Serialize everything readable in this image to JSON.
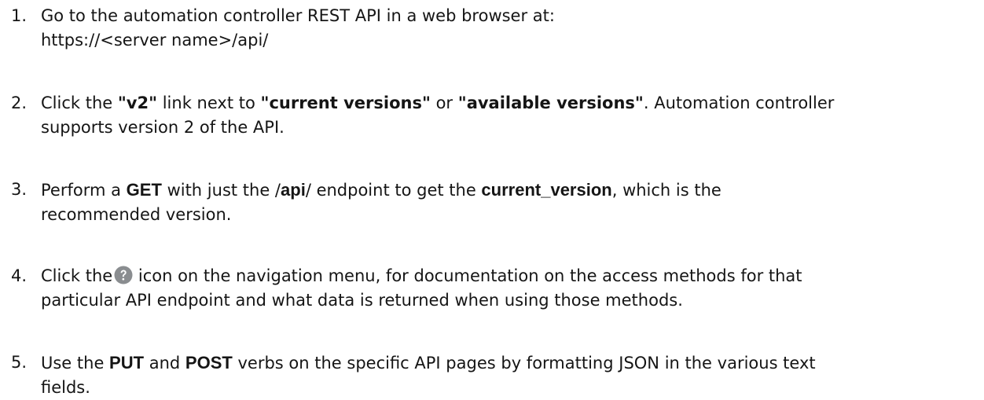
{
  "steps": [
    {
      "number": "1.",
      "lines": [
        [
          "Go to the automation controller REST API in a web browser at:"
        ],
        [
          "https://<server name>/api/"
        ]
      ]
    },
    {
      "number": "2.",
      "l1_a": "Click the ",
      "l1_b": "\"v2\"",
      "l1_c": " link next to  ",
      "l1_d": "\"current versions\"",
      "l1_e": " or ",
      "l1_f": "\"available versions\"",
      "l1_g": ". Automation controller",
      "l2": "supports version 2 of the API."
    },
    {
      "number": "3.",
      "l1_a": "Perform a ",
      "l1_b": "GET",
      "l1_c": " with just the  /",
      "l1_d": "api",
      "l1_e": "/ endpoint to get the  ",
      "l1_f": "current_version",
      "l1_g": ", which is the",
      "l2": "recommended version."
    },
    {
      "number": "4.",
      "l1_a": "Click the",
      "icon": "question-circle-icon",
      "l1_b": " icon on the navigation menu, for documentation on the access methods for that",
      "l2": "particular API endpoint and what data is returned when using those methods."
    },
    {
      "number": "5.",
      "l1_a": "Use the ",
      "l1_b": "PUT",
      "l1_c": " and ",
      "l1_d": "POST",
      "l1_e": " verbs on the specific API pages by formatting JSON in the various text",
      "l2": "fields."
    }
  ],
  "colors": {
    "text": "#151515",
    "icon": "#8a8d90"
  }
}
